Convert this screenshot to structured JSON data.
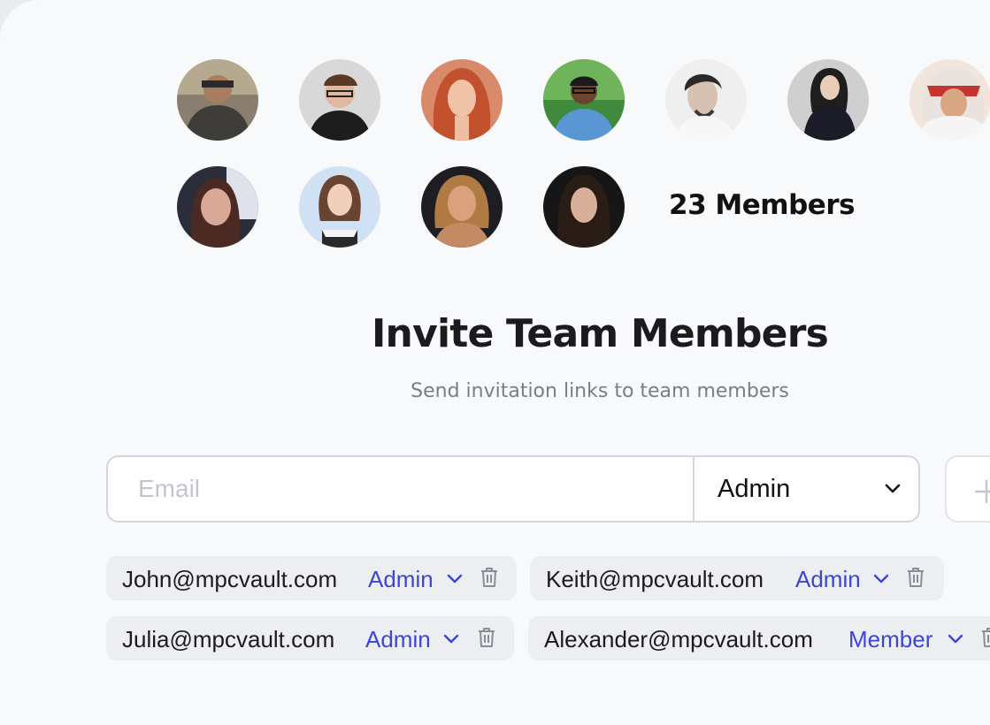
{
  "team": {
    "avatars": [
      {
        "name": "avatar-1"
      },
      {
        "name": "avatar-2"
      },
      {
        "name": "avatar-3"
      },
      {
        "name": "avatar-4"
      },
      {
        "name": "avatar-5"
      },
      {
        "name": "avatar-6"
      },
      {
        "name": "avatar-7"
      },
      {
        "name": "avatar-8"
      },
      {
        "name": "avatar-9"
      },
      {
        "name": "avatar-10"
      },
      {
        "name": "avatar-11"
      }
    ],
    "members_count": "23 Members"
  },
  "invite": {
    "title": "Invite Team Members",
    "subtitle": "Send invitation links to team members",
    "email_placeholder": "Email",
    "email_value": "",
    "role_selected": "Admin",
    "add_icon": "plus-icon"
  },
  "invitees": [
    {
      "email": "John@mpcvault.com",
      "role": "Admin"
    },
    {
      "email": "Keith@mpcvault.com",
      "role": "Admin"
    },
    {
      "email": "Julia@mpcvault.com",
      "role": "Admin"
    },
    {
      "email": "Alexander@mpcvault.com",
      "role": "Member"
    }
  ],
  "colors": {
    "accent": "#3b46d9",
    "background": "#f8f9fb",
    "chip_background": "#eceef2",
    "border": "#d3d6de"
  }
}
